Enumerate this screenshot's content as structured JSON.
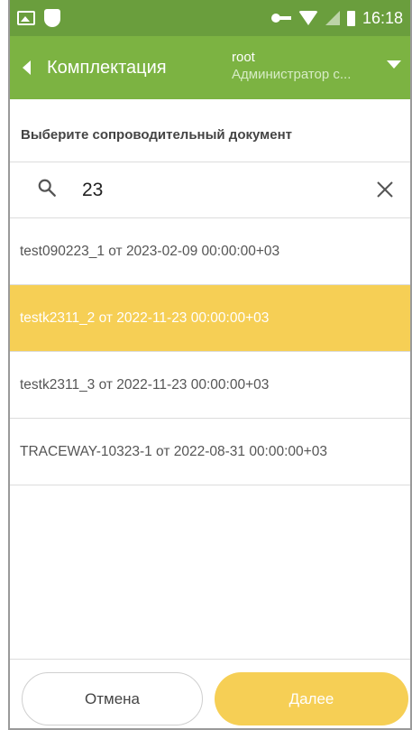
{
  "status_bar": {
    "time": "16:18",
    "icons": [
      "image-icon",
      "shield-icon",
      "vpn-key-icon",
      "wifi-icon",
      "signal-icon",
      "battery-icon"
    ]
  },
  "toolbar": {
    "title": "Комплектация",
    "user_name": "root",
    "user_role": "Администратор с..."
  },
  "page": {
    "section_label": "Выберите сопроводительный документ"
  },
  "search": {
    "value": "23",
    "placeholder": ""
  },
  "documents": [
    {
      "label": "test090223_1 от 2023-02-09 00:00:00+03",
      "selected": false
    },
    {
      "label": "testk2311_2 от 2022-11-23 00:00:00+03",
      "selected": true
    },
    {
      "label": "testk2311_3 от 2022-11-23 00:00:00+03",
      "selected": false
    },
    {
      "label": "TRACEWAY-10323-1 от 2022-08-31 00:00:00+03",
      "selected": false
    }
  ],
  "actions": {
    "cancel_label": "Отмена",
    "next_label": "Далее"
  },
  "colors": {
    "status_bar": "#6a9e3d",
    "toolbar": "#7cb342",
    "accent": "#f6cf55"
  }
}
